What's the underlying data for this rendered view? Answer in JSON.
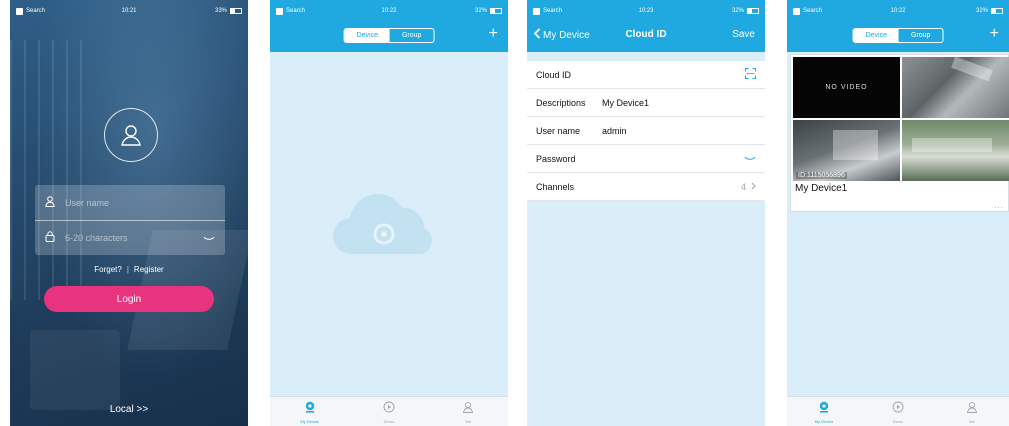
{
  "status": {
    "carrier": "Search",
    "p1_time": "10:21",
    "p1_battery": "33%",
    "p2_time": "10:22",
    "p2_battery": "32%",
    "p3_time": "10:23",
    "p3_battery": "32%",
    "p4_time": "10:22",
    "p4_battery": "32%"
  },
  "login": {
    "username_placeholder": "User name",
    "password_placeholder": "6-20 characters",
    "forget": "Forget?",
    "separator": "|",
    "register": "Register",
    "login_button": "Login",
    "local": "Local >>"
  },
  "device_list": {
    "tab_device": "Device",
    "tab_group": "Group",
    "add_symbol": "+",
    "device_name": "My Device1",
    "device_id": "ID:1115056896",
    "no_video": "NO VIDEO",
    "more": "..."
  },
  "cloud_form": {
    "back_label": "My Device",
    "title": "Cloud ID",
    "save": "Save",
    "rows": [
      {
        "label": "Cloud ID",
        "value": ""
      },
      {
        "label": "Descriptions",
        "value": "My Device1"
      },
      {
        "label": "User name",
        "value": "admin"
      },
      {
        "label": "Password",
        "value": ""
      },
      {
        "label": "Channels",
        "value": "4"
      }
    ]
  },
  "tabbar": {
    "my_device": "My Device",
    "demo": "Demo",
    "me": "Me"
  },
  "colors": {
    "header_blue": "#1fa9e0",
    "content_bg": "#d9eef8",
    "login_pink": "#e8347e"
  },
  "icons": [
    "user-avatar-icon",
    "lock-icon",
    "eye-icon",
    "cloud-icon",
    "qr-scan-icon",
    "chevron-left-icon",
    "chevron-right-icon",
    "play-circle-icon",
    "person-icon",
    "plus-icon"
  ]
}
